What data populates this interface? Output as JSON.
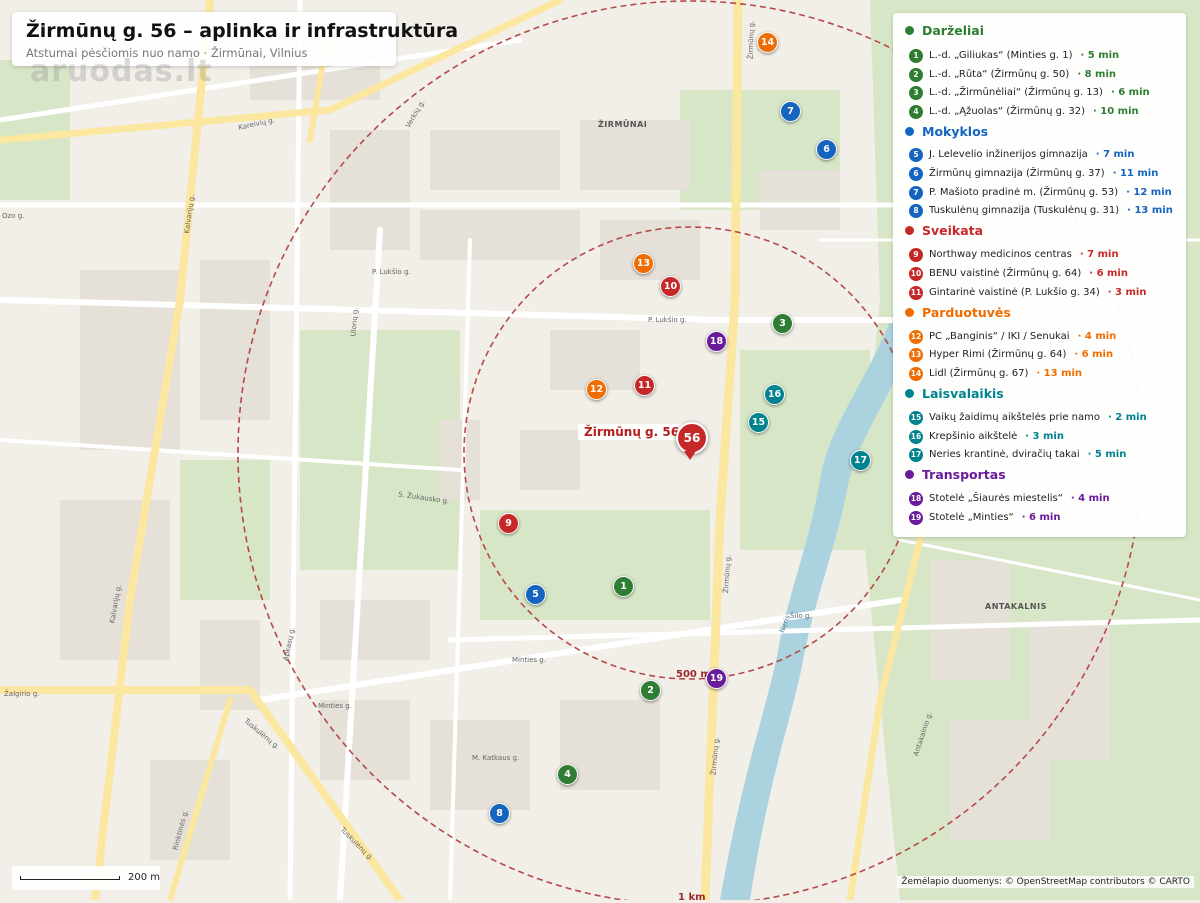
{
  "header": {
    "title": "Žirmūnų g. 56 – aplinka ir infrastruktūra",
    "subtitle": "Atstumai pėsčiomis nuo namo · Žirmūnai, Vilnius"
  },
  "watermark": "aruodas.lt",
  "colors": {
    "darzeliai": "#2e7d32",
    "mokyklos": "#1565c0",
    "sveikata": "#c62828",
    "parduotuves": "#ef6c00",
    "laisvalaikis": "#00838f",
    "transportas": "#6a1b9a",
    "home": "#c62828",
    "ring": "#b44a4a",
    "river": "#aad3df"
  },
  "legend": {
    "categories": [
      {
        "key": "darzeliai",
        "name": "Darželiai",
        "items": [
          {
            "n": "1",
            "label": "L.-d. „Giliukas“ (Minties g. 1)",
            "time": "· 5 min"
          },
          {
            "n": "2",
            "label": "L.-d. „Rūta“ (Žirmūnų g. 50)",
            "time": "· 8 min"
          },
          {
            "n": "3",
            "label": "L.-d. „Žirmūnėliai“ (Žirmūnų g. 13)",
            "time": "· 6 min"
          },
          {
            "n": "4",
            "label": "L.-d. „Ąžuolas“ (Žirmūnų g. 32)",
            "time": "· 10 min"
          }
        ]
      },
      {
        "key": "mokyklos",
        "name": "Mokyklos",
        "items": [
          {
            "n": "5",
            "label": "J. Lelevelio inžinerijos gimnazija",
            "time": "· 7 min"
          },
          {
            "n": "6",
            "label": "Žirmūnų gimnazija (Žirmūnų g. 37)",
            "time": "· 11 min"
          },
          {
            "n": "7",
            "label": "P. Mašioto pradinė m. (Žirmūnų g. 53)",
            "time": "· 12 min"
          },
          {
            "n": "8",
            "label": "Tuskulėnų gimnazija (Tuskulėnų g. 31)",
            "time": "· 13 min"
          }
        ]
      },
      {
        "key": "sveikata",
        "name": "Sveikata",
        "items": [
          {
            "n": "9",
            "label": "Northway medicinos centras",
            "time": "· 7 min"
          },
          {
            "n": "10",
            "label": "BENU vaistinė (Žirmūnų g. 64)",
            "time": "· 6 min"
          },
          {
            "n": "11",
            "label": "Gintarinė vaistinė (P. Lukšio g. 34)",
            "time": "· 3 min"
          }
        ]
      },
      {
        "key": "parduotuves",
        "name": "Parduotuvės",
        "items": [
          {
            "n": "12",
            "label": "PC „Banginis“ / IKI / Senukai",
            "time": "· 4 min"
          },
          {
            "n": "13",
            "label": "Hyper Rimi (Žirmūnų g. 64)",
            "time": "· 6 min"
          },
          {
            "n": "14",
            "label": "Lidl (Žirmūnų g. 67)",
            "time": "· 13 min"
          }
        ]
      },
      {
        "key": "laisvalaikis",
        "name": "Laisvalaikis",
        "items": [
          {
            "n": "15",
            "label": "Vaikų žaidimų aikštelės prie namo",
            "time": "· 2 min"
          },
          {
            "n": "16",
            "label": "Krepšinio aikštelė",
            "time": "· 3 min"
          },
          {
            "n": "17",
            "label": "Neries krantinė, dviračių takai",
            "time": "· 5 min"
          }
        ]
      },
      {
        "key": "transportas",
        "name": "Transportas",
        "items": [
          {
            "n": "18",
            "label": "Stotelė „Šiaurės miestelis“",
            "time": "· 4 min"
          },
          {
            "n": "19",
            "label": "Stotelė „Minties“",
            "time": "· 6 min"
          }
        ]
      }
    ]
  },
  "map": {
    "home_number": "56",
    "home_label": "Žirmūnų g. 56",
    "ring_labels": [
      "500 m",
      "1 km"
    ],
    "districts": [
      "ŽIRMŪNAI",
      "ANTAKALNIS"
    ],
    "streets": [
      "P. Lukšio g.",
      "P. Lukšio g.",
      "Minties g.",
      "Minties g.",
      "Šilo g.",
      "Žirmūnų g.",
      "Žirmūnų g.",
      "Žirmūnų g.",
      "Kareivių g.",
      "Kalvarijų g.",
      "Kalvarijų g.",
      "Ulonų g.",
      "Apkasų g.",
      "Tuskulėnų g.",
      "Tuskulėnų g.",
      "Verkių g.",
      "Antakalnio g.",
      "Žalgirio g.",
      "Rinktinės g.",
      "Ozo g.",
      "Neris",
      "M. Katkaus g.",
      "S. Žukausko g."
    ],
    "pins": [
      {
        "n": "1",
        "cat": "darzeliai"
      },
      {
        "n": "2",
        "cat": "darzeliai"
      },
      {
        "n": "3",
        "cat": "darzeliai"
      },
      {
        "n": "4",
        "cat": "darzeliai"
      },
      {
        "n": "5",
        "cat": "mokyklos"
      },
      {
        "n": "6",
        "cat": "mokyklos"
      },
      {
        "n": "7",
        "cat": "mokyklos"
      },
      {
        "n": "8",
        "cat": "mokyklos"
      },
      {
        "n": "9",
        "cat": "sveikata"
      },
      {
        "n": "10",
        "cat": "sveikata"
      },
      {
        "n": "11",
        "cat": "sveikata"
      },
      {
        "n": "12",
        "cat": "parduotuves"
      },
      {
        "n": "13",
        "cat": "parduotuves"
      },
      {
        "n": "14",
        "cat": "parduotuves"
      },
      {
        "n": "15",
        "cat": "laisvalaikis"
      },
      {
        "n": "16",
        "cat": "laisvalaikis"
      },
      {
        "n": "17",
        "cat": "laisvalaikis"
      },
      {
        "n": "18",
        "cat": "transportas"
      },
      {
        "n": "19",
        "cat": "transportas"
      }
    ]
  },
  "footer": {
    "scale_label": "200 m",
    "attribution": "Žemėlapio duomenys: © OpenStreetMap contributors © CARTO"
  }
}
